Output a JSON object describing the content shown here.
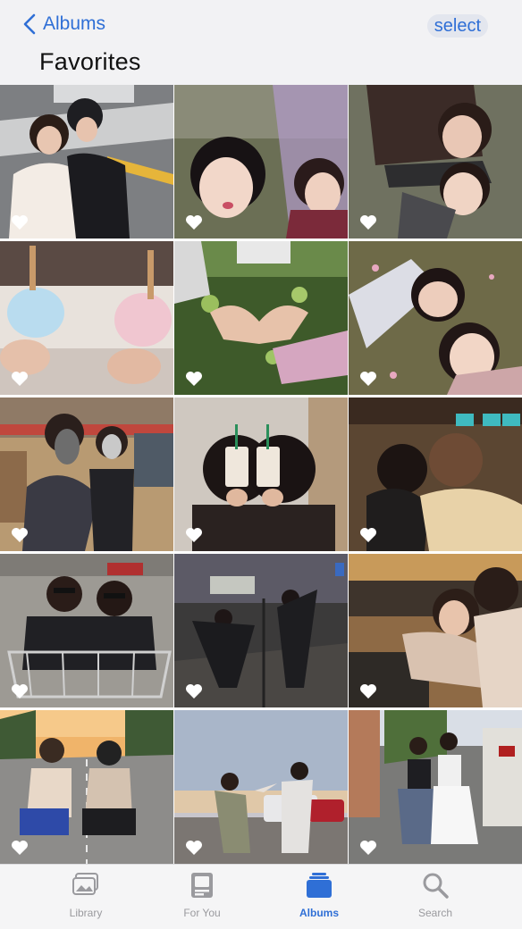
{
  "nav": {
    "back_label": "Albums",
    "select_label": "select"
  },
  "album": {
    "title": "Favorites"
  },
  "photos": [
    {
      "scene": "crosswalk",
      "favorite": true
    },
    {
      "scene": "selfie-park",
      "favorite": true
    },
    {
      "scene": "lying-ground",
      "favorite": true
    },
    {
      "scene": "bubble-tea",
      "favorite": true
    },
    {
      "scene": "hands-heart-grass",
      "favorite": true
    },
    {
      "scene": "lying-flowers",
      "favorite": true
    },
    {
      "scene": "store-toys",
      "favorite": true
    },
    {
      "scene": "cafe-drinks",
      "favorite": true
    },
    {
      "scene": "restaurant-hug",
      "favorite": true
    },
    {
      "scene": "shopping-cart",
      "favorite": true
    },
    {
      "scene": "night-street-dance",
      "favorite": true
    },
    {
      "scene": "booth-laughing",
      "favorite": true
    },
    {
      "scene": "road-sitting",
      "favorite": true
    },
    {
      "scene": "sunset-parking",
      "favorite": true
    },
    {
      "scene": "street-pose",
      "favorite": true
    }
  ],
  "tabs": [
    {
      "label": "Library",
      "icon": "photo-library-icon",
      "active": false
    },
    {
      "label": "For You",
      "icon": "for-you-icon",
      "active": false
    },
    {
      "label": "Albums",
      "icon": "albums-icon",
      "active": true
    },
    {
      "label": "Search",
      "icon": "search-icon",
      "active": false
    }
  ],
  "colors": {
    "accent": "#2f6fd6",
    "inactive": "#9a9a9e"
  }
}
